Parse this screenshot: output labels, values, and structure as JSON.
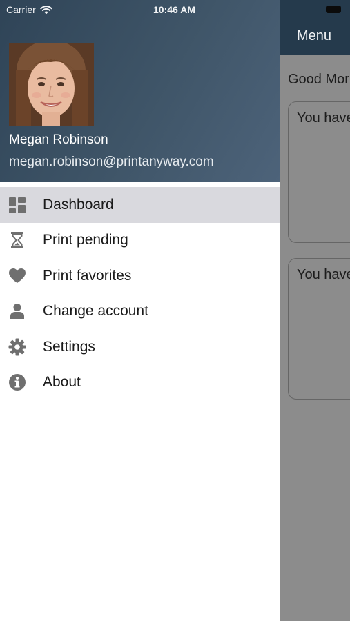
{
  "status_bar": {
    "carrier": "Carrier",
    "time": "10:46 AM"
  },
  "profile": {
    "name": "Megan Robinson",
    "email": "megan.robinson@printanyway.com"
  },
  "menu": {
    "items": [
      {
        "label": "Dashboard",
        "icon": "dashboard-icon",
        "selected": true
      },
      {
        "label": "Print pending",
        "icon": "hourglass-icon",
        "selected": false
      },
      {
        "label": "Print favorites",
        "icon": "heart-icon",
        "selected": false
      },
      {
        "label": "Change account",
        "icon": "user-icon",
        "selected": false
      },
      {
        "label": "Settings",
        "icon": "gear-icon",
        "selected": false
      },
      {
        "label": "About",
        "icon": "info-icon",
        "selected": false
      }
    ]
  },
  "main": {
    "nav_title": "Menu",
    "greeting": "Good Mor",
    "cards": [
      {
        "text": "You have"
      },
      {
        "text": "You have"
      }
    ]
  },
  "colors": {
    "header_bg": "#2f4457",
    "nav_bg": "#253a4c",
    "selected_row": "#d9d9de",
    "icon_gray": "#6f6f6f",
    "overlay_gray": "#8c8c8c"
  }
}
